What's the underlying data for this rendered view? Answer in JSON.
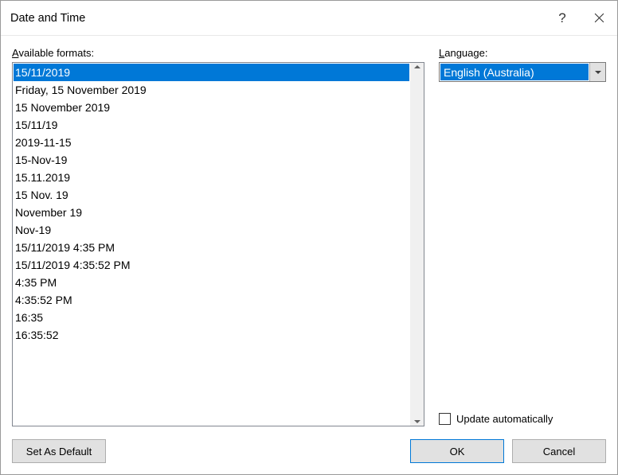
{
  "title": "Date and Time",
  "labels": {
    "available_formats_prefix": "A",
    "available_formats_rest": "vailable formats:",
    "language_prefix": "L",
    "language_rest": "anguage:",
    "update_auto_prefix": "U",
    "update_auto_rest": "pdate automatically"
  },
  "formats": [
    "15/11/2019",
    "Friday, 15 November 2019",
    "15 November 2019",
    "15/11/19",
    "2019-11-15",
    "15-Nov-19",
    "15.11.2019",
    "15 Nov. 19",
    "November 19",
    "Nov-19",
    "15/11/2019 4:35 PM",
    "15/11/2019 4:35:52 PM",
    "4:35 PM",
    "4:35:52 PM",
    "16:35",
    "16:35:52"
  ],
  "selected_format_index": 0,
  "language": {
    "selected": "English (Australia)"
  },
  "update_automatically": false,
  "buttons": {
    "set_default": "Set As Default",
    "ok": "OK",
    "cancel": "Cancel"
  }
}
